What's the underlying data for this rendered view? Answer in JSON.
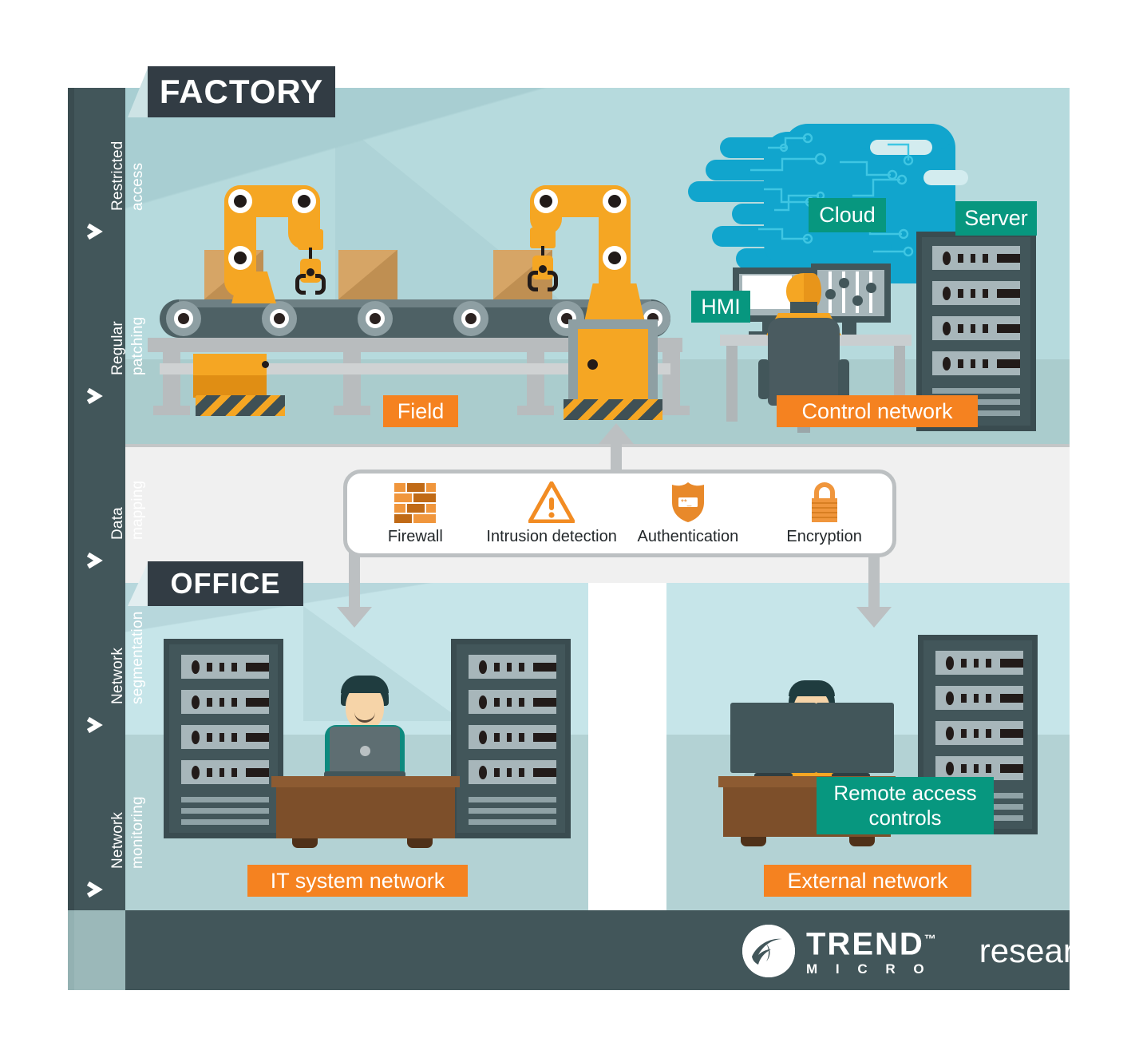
{
  "colors": {
    "dark_slate": "#42565a",
    "banner_dark": "#323c44",
    "factory_bg": "#b6dadd",
    "factory_floor": "#aacccd",
    "office_bg": "#c6e5e9",
    "office_floor": "#b3d2d4",
    "mid_band": "#f0f0f0",
    "orange": "#f58220",
    "teal_green": "#07977f",
    "cloud_blue": "#11a5cd",
    "robot_orange": "#f5a623",
    "pipe_grey": "#bcc0c2",
    "desk_brown": "#8d5b32"
  },
  "sidebar": {
    "items": [
      {
        "label": "Restricted access",
        "name": "restricted-access"
      },
      {
        "label": "Regular patching",
        "name": "regular-patching"
      },
      {
        "label": "Data mapping",
        "name": "data-mapping"
      },
      {
        "label": "Network segmentation",
        "name": "network-segmentation"
      },
      {
        "label": "Network monitoring",
        "name": "network-monitoring"
      }
    ]
  },
  "sections": {
    "factory": {
      "banner": "FACTORY"
    },
    "office": {
      "banner": "OFFICE"
    }
  },
  "factory_tags": {
    "field": "Field",
    "control_network": "Control network",
    "hmi": "HMI",
    "cloud": "Cloud",
    "server": "Server"
  },
  "office_tags": {
    "it_system_network": "IT system network",
    "external_network": "External network",
    "remote_access_controls": "Remote access\ncontrols",
    "remote_access_controls_line1": "Remote access",
    "remote_access_controls_line2": "controls"
  },
  "security_bar": {
    "items": [
      {
        "label": "Firewall",
        "icon": "brick-wall-icon"
      },
      {
        "label": "Intrusion detection",
        "icon": "warning-triangle-icon"
      },
      {
        "label": "Authentication",
        "icon": "shield-password-icon"
      },
      {
        "label": "Encryption",
        "icon": "padlock-icon"
      }
    ]
  },
  "footer": {
    "brand_line1": "TREND",
    "brand_line2": "M I C R O",
    "trademark": "™",
    "product": "research"
  }
}
